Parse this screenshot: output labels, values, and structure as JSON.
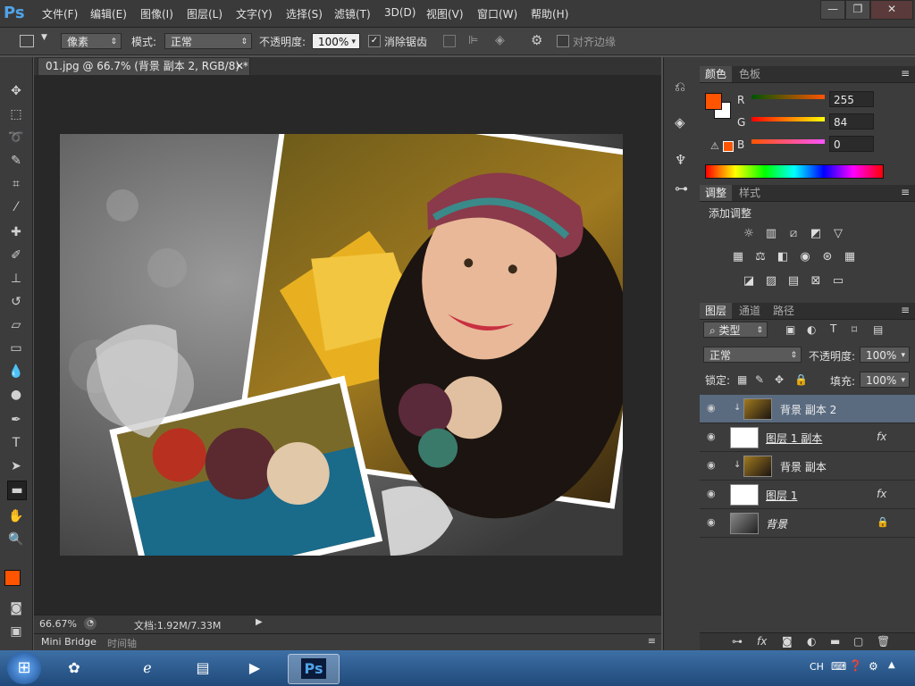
{
  "app": {
    "logo": "Ps"
  },
  "menu": [
    "文件(F)",
    "编辑(E)",
    "图像(I)",
    "图层(L)",
    "文字(Y)",
    "选择(S)",
    "滤镜(T)",
    "3D(D)",
    "视图(V)",
    "窗口(W)",
    "帮助(H)"
  ],
  "window_controls": {
    "minimize": "—",
    "restore": "❐",
    "close": "✕"
  },
  "options": {
    "unit_value": "像素",
    "mode_label": "模式:",
    "mode_value": "正常",
    "opacity_label": "不透明度:",
    "opacity_value": "100%",
    "antialias_label": "消除锯齿",
    "align_edges_label": "对齐边缘"
  },
  "document": {
    "tab_title": "01.jpg @ 66.7% (背景 副本 2, RGB/8) *",
    "zoom": "66.67%",
    "doc_info": "文档:1.92M/7.33M"
  },
  "bottom_tabs": {
    "bridge": "Mini Bridge",
    "timeline": "时间轴"
  },
  "color_panel": {
    "tabs": [
      "颜色",
      "色板"
    ],
    "channels": [
      {
        "label": "R",
        "value": "255"
      },
      {
        "label": "G",
        "value": "84"
      },
      {
        "label": "B",
        "value": "0"
      }
    ],
    "foreground": "#ff5400",
    "background": "#ffffff"
  },
  "adjust_panel": {
    "tabs": [
      "调整",
      "样式"
    ],
    "add_label": "添加调整"
  },
  "layers_panel": {
    "tabs": [
      "图层",
      "通道",
      "路径"
    ],
    "filter_value": "类型",
    "blend_value": "正常",
    "opacity_label": "不透明度:",
    "opacity_value": "100%",
    "lock_label": "锁定:",
    "fill_label": "填充:",
    "fill_value": "100%",
    "layers": [
      {
        "name": "背景 副本 2",
        "fx": "",
        "selected": true
      },
      {
        "name": "图层 1 副本",
        "fx": "fx",
        "selected": false
      },
      {
        "name": "背景 副本",
        "fx": "",
        "selected": false
      },
      {
        "name": "图层 1",
        "fx": "fx",
        "selected": false
      },
      {
        "name": "背景",
        "fx": "",
        "selected": false
      }
    ]
  },
  "taskbar": {
    "lang": "CH"
  }
}
